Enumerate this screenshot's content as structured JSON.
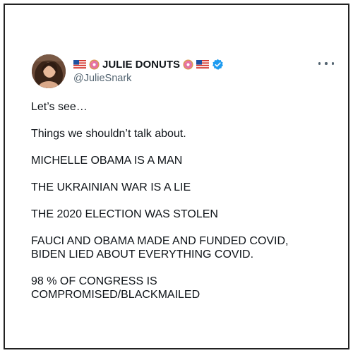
{
  "tweet": {
    "display_name": "JULIE DONUTS",
    "handle": "@JulieSnark",
    "name_emoji_left": [
      "us-flag-icon",
      "donut-icon"
    ],
    "name_emoji_right": [
      "donut-icon",
      "us-flag-icon"
    ],
    "verified": true,
    "more_menu_icon": "more-options-icon",
    "lines": [
      "Let’s see…",
      "Things we shouldn’t talk about.",
      "MICHELLE OBAMA IS A MAN",
      "THE UKRAINIAN WAR IS A LIE",
      "THE 2020 ELECTION WAS STOLEN"
    ],
    "fauci_line_1": "FAUCI AND OBAMA MADE AND FUNDED COVID,",
    "fauci_line_2": "BIDEN LIED ABOUT EVERYTHING COVID.",
    "congress_line_1": "98 % OF CONGRESS IS",
    "congress_line_2": "COMPROMISED/BLACKMAILED"
  },
  "colors": {
    "text": "#0f1419",
    "secondary_text": "#536471",
    "verified_blue": "#1d9bf0",
    "border": "#222222",
    "background": "#ffffff"
  }
}
